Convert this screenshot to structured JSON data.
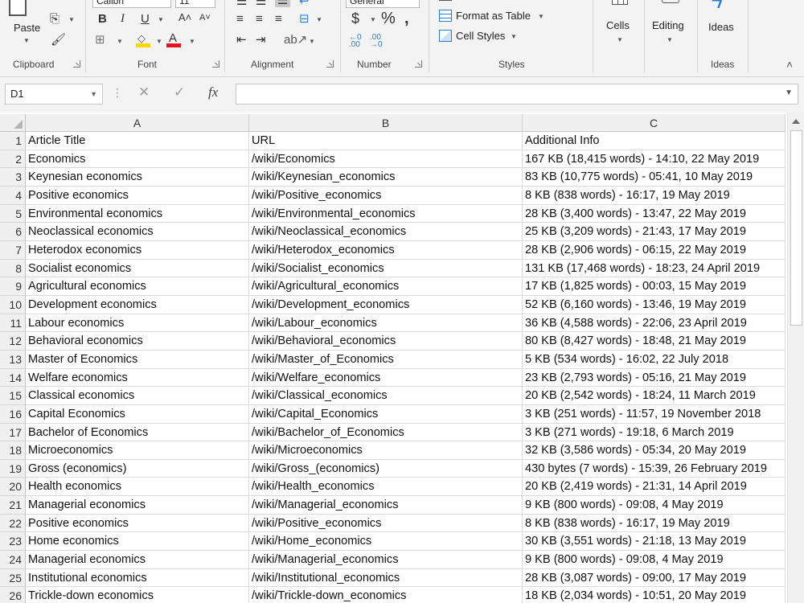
{
  "ribbon": {
    "clipboard": {
      "paste_label": "Paste",
      "group_label": "Clipboard"
    },
    "font": {
      "font_name": "Calibri",
      "font_size": "11",
      "group_label": "Font"
    },
    "alignment": {
      "group_label": "Alignment"
    },
    "number": {
      "format": "General",
      "group_label": "Number"
    },
    "styles": {
      "format_as_table": "Format as Table",
      "cell_styles": "Cell Styles",
      "group_label": "Styles"
    },
    "cells": {
      "label": "Cells"
    },
    "editing": {
      "label": "Editing"
    },
    "ideas": {
      "label": "Ideas",
      "group_label": "Ideas"
    }
  },
  "formula_bar": {
    "name_box": "D1",
    "fx": "fx",
    "content": ""
  },
  "columns": [
    "A",
    "B",
    "C"
  ],
  "rows": [
    {
      "n": "1",
      "a": "Article Title",
      "b": "URL",
      "c": "Additional Info"
    },
    {
      "n": "2",
      "a": "Economics",
      "b": "/wiki/Economics",
      "c": "167 KB (18,415 words) - 14:10, 22 May 2019"
    },
    {
      "n": "3",
      "a": "Keynesian economics",
      "b": "/wiki/Keynesian_economics",
      "c": "83 KB (10,775 words) - 05:41, 10 May 2019"
    },
    {
      "n": "4",
      "a": "Positive economics",
      "b": "/wiki/Positive_economics",
      "c": "8 KB (838 words) - 16:17, 19 May 2019"
    },
    {
      "n": "5",
      "a": "Environmental economics",
      "b": "/wiki/Environmental_economics",
      "c": "28 KB (3,400 words) - 13:47, 22 May 2019"
    },
    {
      "n": "6",
      "a": "Neoclassical economics",
      "b": "/wiki/Neoclassical_economics",
      "c": "25 KB (3,209 words) - 21:43, 17 May 2019"
    },
    {
      "n": "7",
      "a": "Heterodox economics",
      "b": "/wiki/Heterodox_economics",
      "c": "28 KB (2,906 words) - 06:15, 22 May 2019"
    },
    {
      "n": "8",
      "a": "Socialist economics",
      "b": "/wiki/Socialist_economics",
      "c": "131 KB (17,468 words) - 18:23, 24 April 2019"
    },
    {
      "n": "9",
      "a": "Agricultural economics",
      "b": "/wiki/Agricultural_economics",
      "c": "17 KB (1,825 words) - 00:03, 15 May 2019"
    },
    {
      "n": "10",
      "a": "Development economics",
      "b": "/wiki/Development_economics",
      "c": "52 KB (6,160 words) - 13:46, 19 May 2019"
    },
    {
      "n": "11",
      "a": "Labour economics",
      "b": "/wiki/Labour_economics",
      "c": "36 KB (4,588 words) - 22:06, 23 April 2019"
    },
    {
      "n": "12",
      "a": "Behavioral economics",
      "b": "/wiki/Behavioral_economics",
      "c": "80 KB (8,427 words) - 18:48, 21 May 2019"
    },
    {
      "n": "13",
      "a": "Master of Economics",
      "b": "/wiki/Master_of_Economics",
      "c": "5 KB (534 words) - 16:02, 22 July 2018"
    },
    {
      "n": "14",
      "a": "Welfare economics",
      "b": "/wiki/Welfare_economics",
      "c": "23 KB (2,793 words) - 05:16, 21 May 2019"
    },
    {
      "n": "15",
      "a": "Classical economics",
      "b": "/wiki/Classical_economics",
      "c": "20 KB (2,542 words) - 18:24, 11 March 2019"
    },
    {
      "n": "16",
      "a": "Capital Economics",
      "b": "/wiki/Capital_Economics",
      "c": "3 KB (251 words) - 11:57, 19 November 2018"
    },
    {
      "n": "17",
      "a": "Bachelor of Economics",
      "b": "/wiki/Bachelor_of_Economics",
      "c": "3 KB (271 words) - 19:18, 6 March 2019"
    },
    {
      "n": "18",
      "a": "Microeconomics",
      "b": "/wiki/Microeconomics",
      "c": "32 KB (3,586 words) - 05:34, 20 May 2019"
    },
    {
      "n": "19",
      "a": "Gross (economics)",
      "b": "/wiki/Gross_(economics)",
      "c": "430 bytes (7 words) - 15:39, 26 February 2019"
    },
    {
      "n": "20",
      "a": "Health economics",
      "b": "/wiki/Health_economics",
      "c": "20 KB (2,419 words) - 21:31, 14 April 2019"
    },
    {
      "n": "21",
      "a": "Managerial economics",
      "b": "/wiki/Managerial_economics",
      "c": "9 KB (800 words) - 09:08, 4 May 2019"
    },
    {
      "n": "22",
      "a": "Positive economics",
      "b": "/wiki/Positive_economics",
      "c": "8 KB (838 words) - 16:17, 19 May 2019"
    },
    {
      "n": "23",
      "a": "Home economics",
      "b": "/wiki/Home_economics",
      "c": "30 KB (3,551 words) - 21:18, 13 May 2019"
    },
    {
      "n": "24",
      "a": "Managerial economics",
      "b": "/wiki/Managerial_economics",
      "c": "9 KB (800 words) - 09:08, 4 May 2019"
    },
    {
      "n": "25",
      "a": "Institutional economics",
      "b": "/wiki/Institutional_economics",
      "c": "28 KB (3,087 words) - 09:00, 17 May 2019"
    },
    {
      "n": "26",
      "a": "Trickle-down economics",
      "b": "/wiki/Trickle-down_economics",
      "c": "18 KB (2,034 words) - 10:51, 20 May 2019"
    }
  ],
  "colors": {
    "ribbon_bg": "#f3f3f3",
    "header_bg": "#f0f0f0",
    "gridline": "#dadada",
    "accent_blue": "#2b7cd3",
    "font_color_red": "#e81123",
    "fill_yellow": "#ffd700"
  }
}
